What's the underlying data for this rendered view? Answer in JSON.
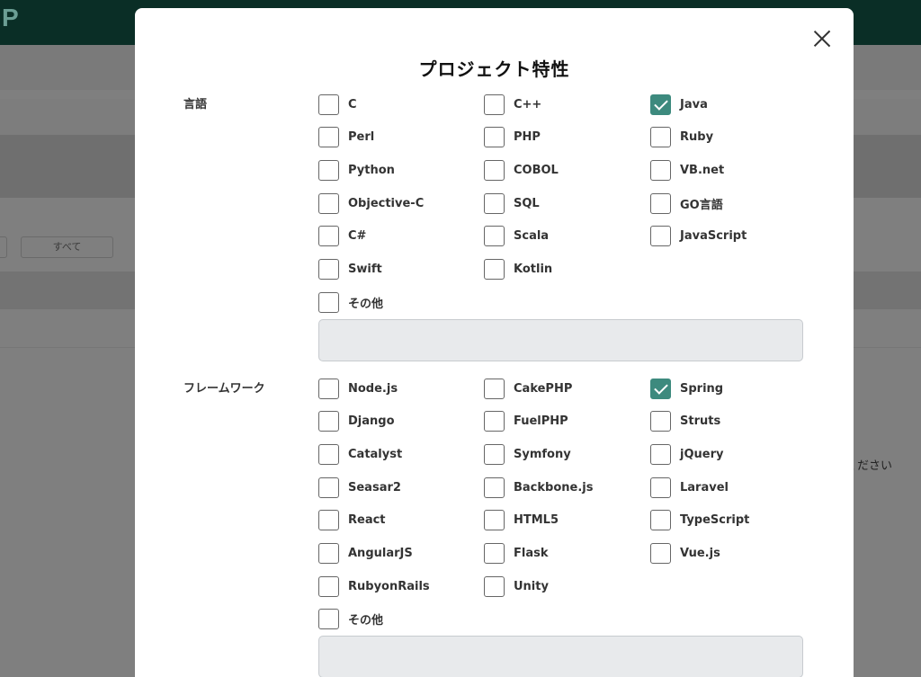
{
  "background": {
    "logo": "P",
    "all_button": "すべて",
    "right_text": "ください"
  },
  "modal": {
    "title": "プロジェクト特性",
    "languages": {
      "label": "言語",
      "options": [
        {
          "label": "C",
          "checked": false
        },
        {
          "label": "C++",
          "checked": false
        },
        {
          "label": "Java",
          "checked": true
        },
        {
          "label": "Perl",
          "checked": false
        },
        {
          "label": "PHP",
          "checked": false
        },
        {
          "label": "Ruby",
          "checked": false
        },
        {
          "label": "Python",
          "checked": false
        },
        {
          "label": "COBOL",
          "checked": false
        },
        {
          "label": "VB.net",
          "checked": false
        },
        {
          "label": "Objective-C",
          "checked": false
        },
        {
          "label": "SQL",
          "checked": false
        },
        {
          "label": "GO言語",
          "checked": false
        },
        {
          "label": "C#",
          "checked": false
        },
        {
          "label": "Scala",
          "checked": false
        },
        {
          "label": "JavaScript",
          "checked": false
        },
        {
          "label": "Swift",
          "checked": false
        },
        {
          "label": "Kotlin",
          "checked": false
        }
      ],
      "other_label": "その他",
      "other_value": ""
    },
    "frameworks": {
      "label": "フレームワーク",
      "options": [
        {
          "label": "Node.js",
          "checked": false
        },
        {
          "label": "CakePHP",
          "checked": false
        },
        {
          "label": "Spring",
          "checked": true
        },
        {
          "label": "Django",
          "checked": false
        },
        {
          "label": "FuelPHP",
          "checked": false
        },
        {
          "label": "Struts",
          "checked": false
        },
        {
          "label": "Catalyst",
          "checked": false
        },
        {
          "label": "Symfony",
          "checked": false
        },
        {
          "label": "jQuery",
          "checked": false
        },
        {
          "label": "Seasar2",
          "checked": false
        },
        {
          "label": "Backbone.js",
          "checked": false
        },
        {
          "label": "Laravel",
          "checked": false
        },
        {
          "label": "React",
          "checked": false
        },
        {
          "label": "HTML5",
          "checked": false
        },
        {
          "label": "TypeScript",
          "checked": false
        },
        {
          "label": "AngularJS",
          "checked": false
        },
        {
          "label": "Flask",
          "checked": false
        },
        {
          "label": "Vue.js",
          "checked": false
        },
        {
          "label": "RubyonRails",
          "checked": false
        },
        {
          "label": "Unity",
          "checked": false
        }
      ],
      "other_label": "その他",
      "other_value": ""
    }
  },
  "colors": {
    "accent": "#3d8a7e",
    "header": "#0a2e26",
    "overlay": "#7f7f7f"
  }
}
